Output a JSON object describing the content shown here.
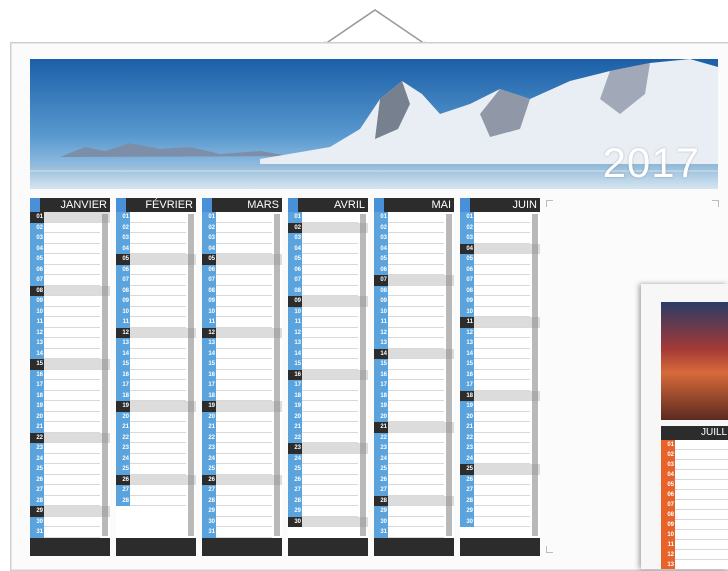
{
  "calendar": {
    "year": "2017",
    "months": [
      {
        "name": "JANVIER"
      },
      {
        "name": "FÉVRIER"
      },
      {
        "name": "MARS"
      },
      {
        "name": "AVRIL"
      },
      {
        "name": "MAI"
      },
      {
        "name": "JUIN"
      }
    ],
    "second_sheet_month": "JUILL"
  },
  "colors": {
    "accent_blue": "#5aa3dc",
    "accent_orange": "#e8632a",
    "header_dark": "#2c2c2c"
  }
}
